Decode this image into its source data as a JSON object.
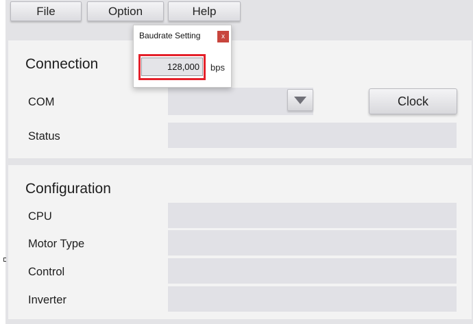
{
  "menu": {
    "file": "File",
    "option": "Option",
    "help": "Help"
  },
  "connection": {
    "title": "Connection",
    "com_label": "COM",
    "com_value": "",
    "clock_button": "Clock",
    "status_label": "Status",
    "status_value": ""
  },
  "configuration": {
    "title": "Configuration",
    "cpu_label": "CPU",
    "motor_type_label": "Motor Type",
    "control_label": "Control",
    "inverter_label": "Inverter"
  },
  "baud_dialog": {
    "title": "Baudrate Setting",
    "close": "x",
    "value": "128,000",
    "unit": "bps",
    "highlight_color": "#e4202a"
  },
  "icons": {
    "combo_arrow": "chevron-down-icon",
    "dialog_close": "close-icon"
  }
}
